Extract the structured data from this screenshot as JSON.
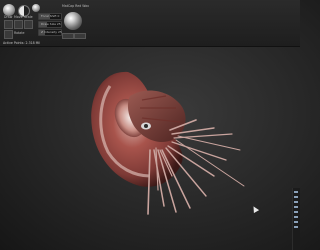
{
  "toolbar": {
    "tools": [
      "Draw",
      "Move",
      "Scale",
      "Rotate"
    ],
    "sliders": {
      "focal_shift": {
        "label": "Focal Shift 0",
        "value": 0.5
      },
      "draw_size": {
        "label": "Draw Size 25",
        "value": 0.35
      },
      "z_intensity": {
        "label": "Z Intensity 25",
        "value": 0.25
      }
    },
    "material_label": "MatCap Red Wax",
    "status": "Active Points: 2.318 Mil"
  },
  "icons": {
    "brush": "brush-icon",
    "half_sphere": "stroke-icon",
    "material": "material-sphere-icon"
  },
  "colors": {
    "viewport_bg": "#2a2a2a",
    "model_base": "#7e3a36",
    "model_highlight": "#d9b4ad"
  }
}
